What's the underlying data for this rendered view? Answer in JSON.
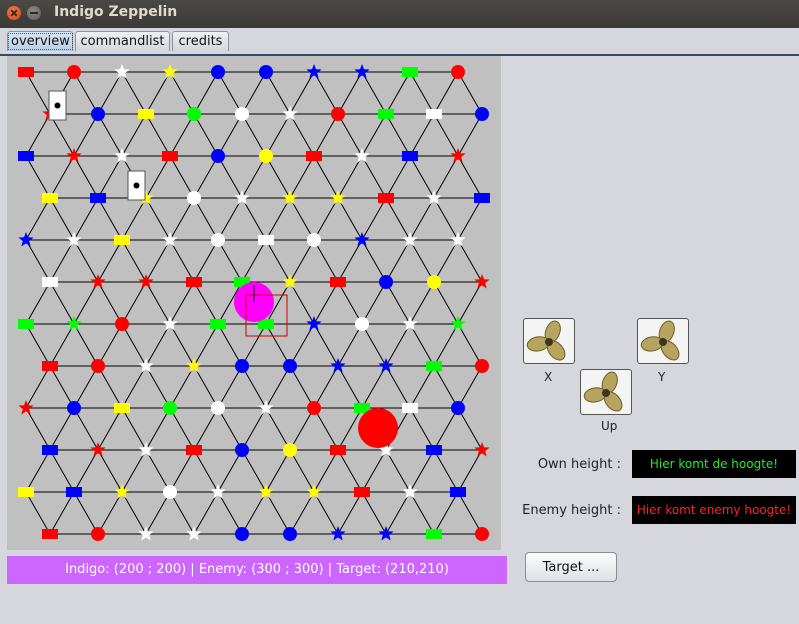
{
  "window": {
    "title": "Indigo Zeppelin"
  },
  "tabs": [
    "overview",
    "commandlist",
    "credits"
  ],
  "status_text": "Indigo: (200 ; 200)  |  Enemy: (300 ; 300)  |  Target: (210,210)",
  "controls": {
    "x_label": "X",
    "y_label": "Y",
    "up_label": "Up",
    "own_height_label": "Own height :",
    "own_height_value": "Hier komt de hoogte!",
    "enemy_height_label": "Enemy height :",
    "enemy_height_value": "Hier komt enemy hoogte!",
    "target_button": "Target ..."
  },
  "colors": {
    "own_height_text": "#22ee22",
    "enemy_height_text": "#ff2222",
    "status_bg": "#cc66ff",
    "indigo_zeppelin": "#ff00ff",
    "enemy_zeppelin": "#ff0000"
  },
  "board": {
    "rows": [
      [
        "red rect",
        "red circle",
        "white star",
        "yellow star",
        "blue circle",
        "blue circle",
        "blue star",
        "blue star",
        "green rect",
        "red circle"
      ],
      [
        "red star",
        "blue circle",
        "yellow rect",
        "green circle",
        "white circle",
        "white star",
        "red circle",
        "green rect",
        "white rect",
        "blue circle"
      ],
      [
        "blue rect",
        "red star",
        "white star",
        "red rect",
        "blue circle",
        "yellow circle",
        "red rect",
        "white star",
        "blue rect",
        "red star"
      ],
      [
        "yellow rect",
        "blue rect",
        "yellow star",
        "white circle",
        "white star",
        "yellow star",
        "yellow star",
        "red rect",
        "white star",
        "blue rect"
      ],
      [
        "blue star",
        "white star",
        "yellow rect",
        "white star",
        "white circle",
        "white rect",
        "white circle",
        "blue star",
        "white star",
        "white star"
      ],
      [
        "white rect",
        "red star",
        "red star",
        "red rect",
        "green rect",
        "yellow star",
        "red rect",
        "blue circle",
        "yellow circle",
        "red star"
      ],
      [
        "green rect",
        "green star",
        "red circle",
        "white star",
        "green rect",
        "green rect",
        "blue star",
        "white circle",
        "white star",
        "green star"
      ],
      [
        "red rect",
        "red circle",
        "white star",
        "yellow star",
        "blue circle",
        "blue circle",
        "blue star",
        "blue star",
        "green rect",
        "red circle"
      ],
      [
        "red star",
        "blue circle",
        "yellow rect",
        "green circle",
        "white circle",
        "white star",
        "red circle",
        "green rect",
        "white rect",
        "blue circle"
      ],
      [
        "blue rect",
        "red star",
        "white star",
        "red rect",
        "blue circle",
        "yellow circle",
        "red rect",
        "white star",
        "blue rect",
        "red star"
      ],
      [
        "yellow rect",
        "blue rect",
        "yellow star",
        "white circle",
        "white star",
        "yellow star",
        "yellow star",
        "red rect",
        "white star",
        "blue rect"
      ],
      [
        "red rect",
        "red circle",
        "white star",
        "white star",
        "blue circle",
        "blue circle",
        "blue star",
        "blue star",
        "green rect",
        "red circle"
      ]
    ],
    "zeppelins": [
      "indigo",
      "enemy"
    ],
    "markers": [
      "card",
      "card"
    ]
  }
}
